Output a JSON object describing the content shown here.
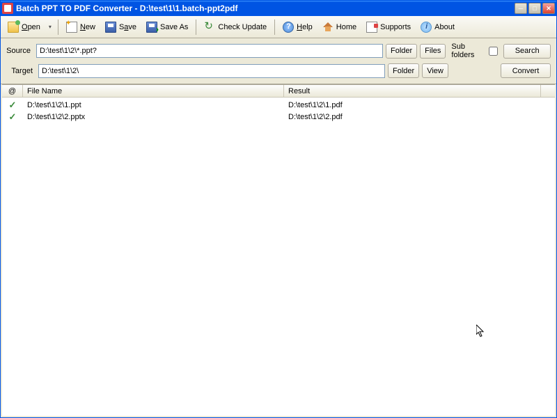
{
  "window": {
    "title": "Batch PPT TO PDF Converter - D:\\test\\1\\1.batch-ppt2pdf"
  },
  "toolbar": {
    "open": "Open",
    "new": "New",
    "save": "Save",
    "saveas": "Save As",
    "check": "Check Update",
    "help": "Help",
    "home": "Home",
    "supports": "Supports",
    "about": "About"
  },
  "panel": {
    "source_label": "Source",
    "source_value": "D:\\test\\1\\2\\*.ppt?",
    "target_label": "Target",
    "target_value": "D:\\test\\1\\2\\",
    "folder_btn": "Folder",
    "files_btn": "Files",
    "view_btn": "View",
    "subfolders_label": "Sub folders",
    "subfolders_checked": false,
    "search_btn": "Search",
    "convert_btn": "Convert"
  },
  "list": {
    "col_at": "@",
    "col_filename": "File Name",
    "col_result": "Result",
    "rows": [
      {
        "status": "ok",
        "filename": "D:\\test\\1\\2\\1.ppt",
        "result": "D:\\test\\1\\2\\1.pdf"
      },
      {
        "status": "ok",
        "filename": "D:\\test\\1\\2\\2.pptx",
        "result": "D:\\test\\1\\2\\2.pdf"
      }
    ]
  }
}
